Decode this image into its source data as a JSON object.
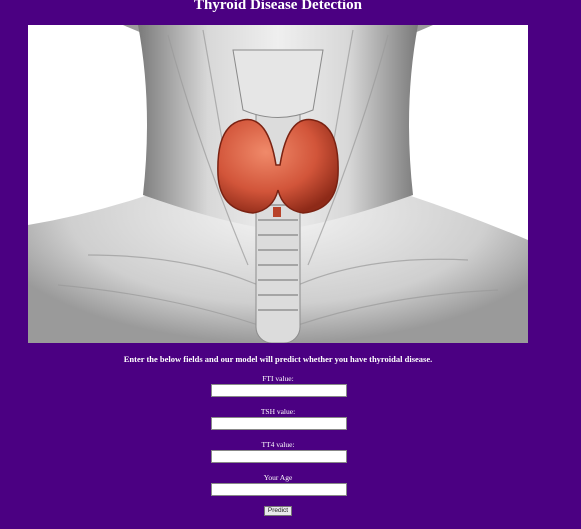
{
  "page": {
    "title": "Thyroid Disease Detection"
  },
  "intro": "Enter the below fields and our model will predict whether you have thyroidal disease.",
  "form": {
    "fields": [
      {
        "label": "FTI value:",
        "value": ""
      },
      {
        "label": "TSH value:",
        "value": ""
      },
      {
        "label": "TT4 value:",
        "value": ""
      },
      {
        "label": "Your Age",
        "value": ""
      }
    ],
    "submit_label": "Predict"
  },
  "colors": {
    "background": "#4b0082",
    "thyroid": "#d2553a"
  }
}
